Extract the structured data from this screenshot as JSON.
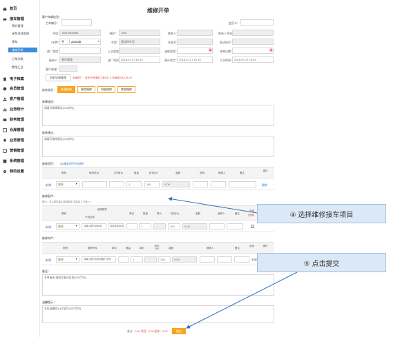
{
  "sidebar": {
    "home": "首页",
    "repair_mgmt": "接车管理",
    "sub_items": [
      "预约管理",
      "接车项目管理",
      "接车",
      "维修开单",
      "订单列表",
      "费用汇总"
    ],
    "items": [
      "电子档案",
      "会员管理",
      "客户管理",
      "业务统计",
      "财务管理",
      "仓库管理",
      "业务管理",
      "营销管理",
      "系统管理",
      "我的设置"
    ]
  },
  "page": {
    "title": "维修开单",
    "customer_section": "客户车辆信息：",
    "work_order_label": "工单编号：",
    "member_card_label": "会员卡：",
    "fields": {
      "phone_label": "手机：",
      "phone_value": "18819658888",
      "customer_label": "*客户：",
      "customer_value": "Jose",
      "contact_label": "联系人：",
      "contact_phone_label": "联系人手机：",
      "plate_label": "*车牌：",
      "plate_prefix": "粤",
      "plate_value": "A12345",
      "model_label": "车型：",
      "model_value": "奥迪四车型",
      "vin_label": "车架号：",
      "engine_label": "发动机号：",
      "factory_mileage_label": "进厂里程：",
      "last_mileage_label": "上次里程：",
      "oil_label": "油耗里程：",
      "annual_label": "年审日期：",
      "operator_label": "接待人：",
      "operator_value": "夏氏管理",
      "in_time_label": "进厂时间：",
      "in_time_value": "2018-07-27 15:15",
      "planned_label": "预计完工：",
      "planned_value": "2018-07-27 15:15",
      "next_label": "下次时间：",
      "next_value": "2018-07-27 15:15",
      "source_label": "客户来源："
    },
    "history_button": "历史记录查询",
    "history_note": "本维修厂：该车已有维修工单0次 上次维修2018-06-22",
    "repair_type_label": "维修类型：",
    "repair_types": [
      "普通维修",
      "保险维修",
      "内部维修",
      "其他维修"
    ],
    "fault_label": "故障描述：",
    "fault_placeholder": "请填写故障情况(200字内)",
    "advice_label": "维修建议：",
    "advice_placeholder": "请填写维修建议(200字内)",
    "project_label": "维修项目：",
    "project_link": "（从服务项目中选择）",
    "project_headers": [
      "类别",
      "维修项目",
      "工时单价",
      "数量",
      "折扣(%)",
      "金额",
      "说明",
      "维修人",
      "备注",
      "操作"
    ],
    "project_row": {
      "add": "新增",
      "category": "保养",
      "qty": "1",
      "discount": "100",
      "amount": "0.00",
      "delete": "删除"
    },
    "parts_label": "维修配件：",
    "parts_hint": "提示：可从配件库中选择配件 选择加工产品>>",
    "parts_headers": [
      "类别",
      "维修配件",
      "产品名称",
      "单位",
      "数量",
      "单价",
      "折扣(%)",
      "金额",
      "维修人",
      "备注",
      "出库",
      "操作"
    ],
    "parts_row": {
      "add": "新增",
      "category": "保养",
      "name_placeholder": "请输入配件名称或",
      "supplier": "请选择供应商",
      "qty": "1",
      "discount": "100",
      "amount": "0.00",
      "stock_note": "(全部)"
    },
    "other_label": "维修外件：",
    "other_headers": [
      "类别",
      "维修外件",
      "单位",
      "数量",
      "单价",
      "折扣(%)",
      "金额",
      "维修人",
      "备注",
      "出库",
      "操作"
    ],
    "other_row": {
      "add": "新增",
      "category": "保养",
      "name_placeholder": "请输入配件名称或客户名称",
      "qty": "1",
      "discount": "100",
      "amount": "0.00",
      "stock_note": "未添加"
    },
    "remark_label": "备注：",
    "remark_placeholder": "本单备注(请填写备注信息)(200字内)",
    "reminder_label": "温馨提示：",
    "reminder_placeholder": "本店温馨提示(可填写)(200字内)",
    "summary_prefix": "合计：",
    "summary_values": "0.00 项目：0.00 配件：0.00",
    "submit_button": "提交"
  },
  "callouts": {
    "step4": "④ 选择维修接车项目",
    "step5": "⑤ 点击提交"
  },
  "colors": {
    "accent": "#f5a623",
    "sidebar_active": "#3a8ed8",
    "callout_bg": "#dbe8f6",
    "arrow": "#2e6fc4"
  }
}
